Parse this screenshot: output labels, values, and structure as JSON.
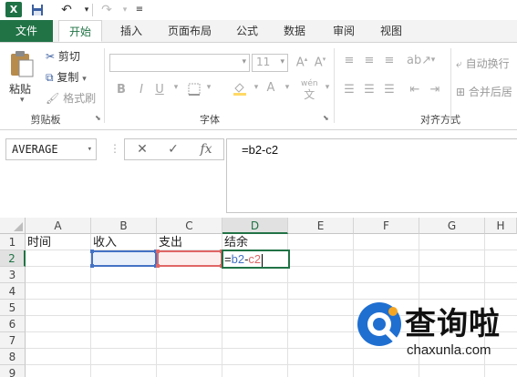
{
  "titlebar": {
    "app_icon_letter": "X",
    "save_icon": "save-icon",
    "undo_icon": "undo-icon",
    "redo_icon": "redo-icon",
    "customize_icon": "customize-qat-icon"
  },
  "tabs": {
    "file": "文件",
    "items": [
      "开始",
      "插入",
      "页面布局",
      "公式",
      "数据",
      "审阅",
      "视图"
    ]
  },
  "ribbon": {
    "clipboard": {
      "paste": "粘贴",
      "cut": "剪切",
      "copy": "复制",
      "format_painter": "格式刷",
      "group_label": "剪贴板"
    },
    "font": {
      "font_name": "",
      "font_size": "11",
      "bold": "B",
      "italic": "I",
      "underline": "U",
      "font_color_glyph": "A",
      "phonetic": "wén",
      "group_label": "字体"
    },
    "alignment": {
      "wrap_text": "自动换行",
      "merge_center": "合并后居",
      "group_label": "对齐方式"
    }
  },
  "formula_bar": {
    "name_box": "AVERAGE",
    "cancel": "✕",
    "enter": "✓",
    "fx": "fx",
    "formula": "=b2-c2"
  },
  "sheet": {
    "columns": [
      "A",
      "B",
      "C",
      "D",
      "E",
      "F",
      "G",
      "H"
    ],
    "rows": [
      "1",
      "2",
      "3",
      "4",
      "5",
      "6",
      "7",
      "8",
      "9"
    ],
    "row1": [
      "时间",
      "收入",
      "支出",
      "结余"
    ],
    "edit_cell": {
      "eq": "=",
      "ref1": "b2",
      "minus": "-",
      "ref2": "c2"
    }
  },
  "colors": {
    "accent": "#217346",
    "ref1_color": "#4472c4",
    "ref2_color": "#e06666"
  },
  "watermark": {
    "title": "查询啦",
    "url": "chaxunla.com"
  }
}
